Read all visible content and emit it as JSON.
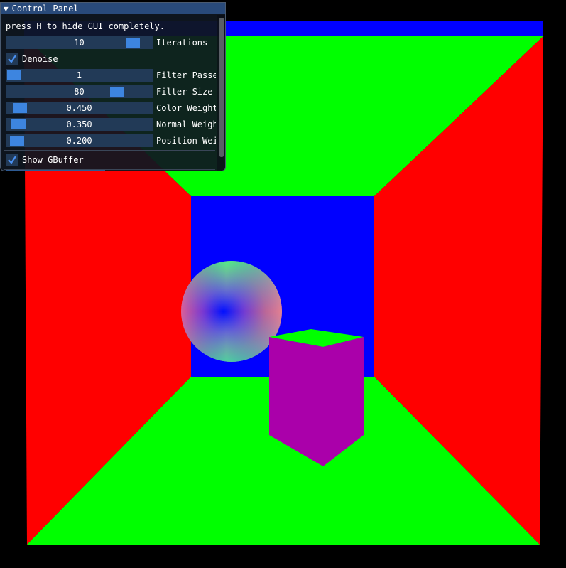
{
  "colors": {
    "background": "#000000",
    "back_wall": "#0000ff",
    "side_walls": "#ff0000",
    "floor_ceiling": "#00ff00",
    "box": "#aa00aa",
    "box_top": "#00ff00",
    "panel_bg": "#0f1620",
    "panel_title": "#294a7a",
    "slider_bg": "#223a57",
    "slider_grab": "#3d85e0"
  },
  "panel": {
    "title": "Control Panel",
    "collapse_icon": "triangle-down",
    "hint": "press H to hide GUI completely.",
    "sliders": [
      {
        "id": "iterations",
        "value": "10",
        "label": "Iterations",
        "fraction": 0.91
      },
      {
        "id": "filter-passes",
        "value": "1",
        "label": "Filter Passe",
        "fraction": 0.0
      },
      {
        "id": "filter-size",
        "value": "80",
        "label": "Filter Size",
        "fraction": 0.79
      },
      {
        "id": "color-weight",
        "value": "0.450",
        "label": "Color Weight",
        "fraction": 0.045
      },
      {
        "id": "normal-weight",
        "value": "0.350",
        "label": "Normal Weigh",
        "fraction": 0.035
      },
      {
        "id": "position-weight",
        "value": "0.200",
        "label": "Position Wei",
        "fraction": 0.02
      }
    ],
    "checkboxes": {
      "denoise": {
        "label": "Denoise",
        "checked": true
      },
      "show_gbuffer": {
        "label": "Show GBuffer",
        "checked": true
      }
    }
  }
}
